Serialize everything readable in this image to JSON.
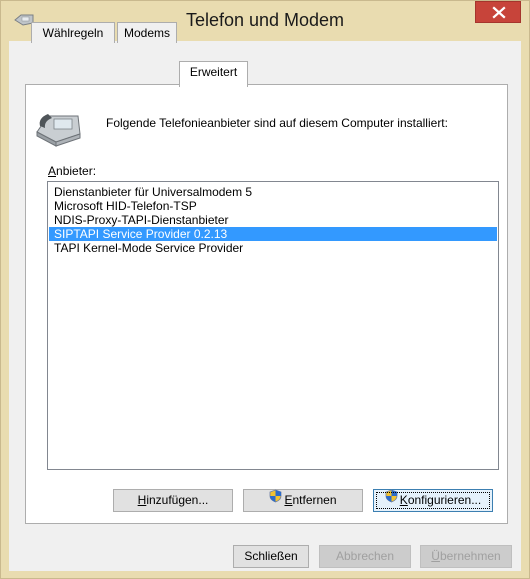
{
  "window": {
    "title": "Telefon und Modem"
  },
  "tabs": [
    {
      "label": "Wählregeln"
    },
    {
      "label": "Modems"
    },
    {
      "label": "Erweitert"
    }
  ],
  "active_tab": "Erweitert",
  "info_text": "Folgende Telefonieanbieter sind auf diesem Computer installiert:",
  "providers": {
    "label_first": "A",
    "label_rest": "nbieter:",
    "items": [
      "Dienstanbieter für Universalmodem 5",
      "Microsoft HID-Telefon-TSP",
      "NDIS-Proxy-TAPI-Dienstanbieter",
      "SIPTAPI Service Provider 0.2.13",
      "TAPI Kernel-Mode Service Provider"
    ],
    "selected": "SIPTAPI Service Provider 0.2.13"
  },
  "buttons": {
    "add": {
      "u": "H",
      "rest": "inzufügen..."
    },
    "remove": {
      "u": "E",
      "rest": "ntfernen"
    },
    "configure": {
      "u": "K",
      "rest": "onfigurieren..."
    },
    "close": "Schließen",
    "cancel": "Abbrechen",
    "apply": {
      "u": "Ü",
      "rest": "bernehmen"
    }
  },
  "colors": {
    "titlebar": "#e9dcb0",
    "close_button": "#c7443a",
    "selection": "#3399ff"
  },
  "icons": [
    "phone-icon",
    "shield-icon",
    "close-icon"
  ]
}
